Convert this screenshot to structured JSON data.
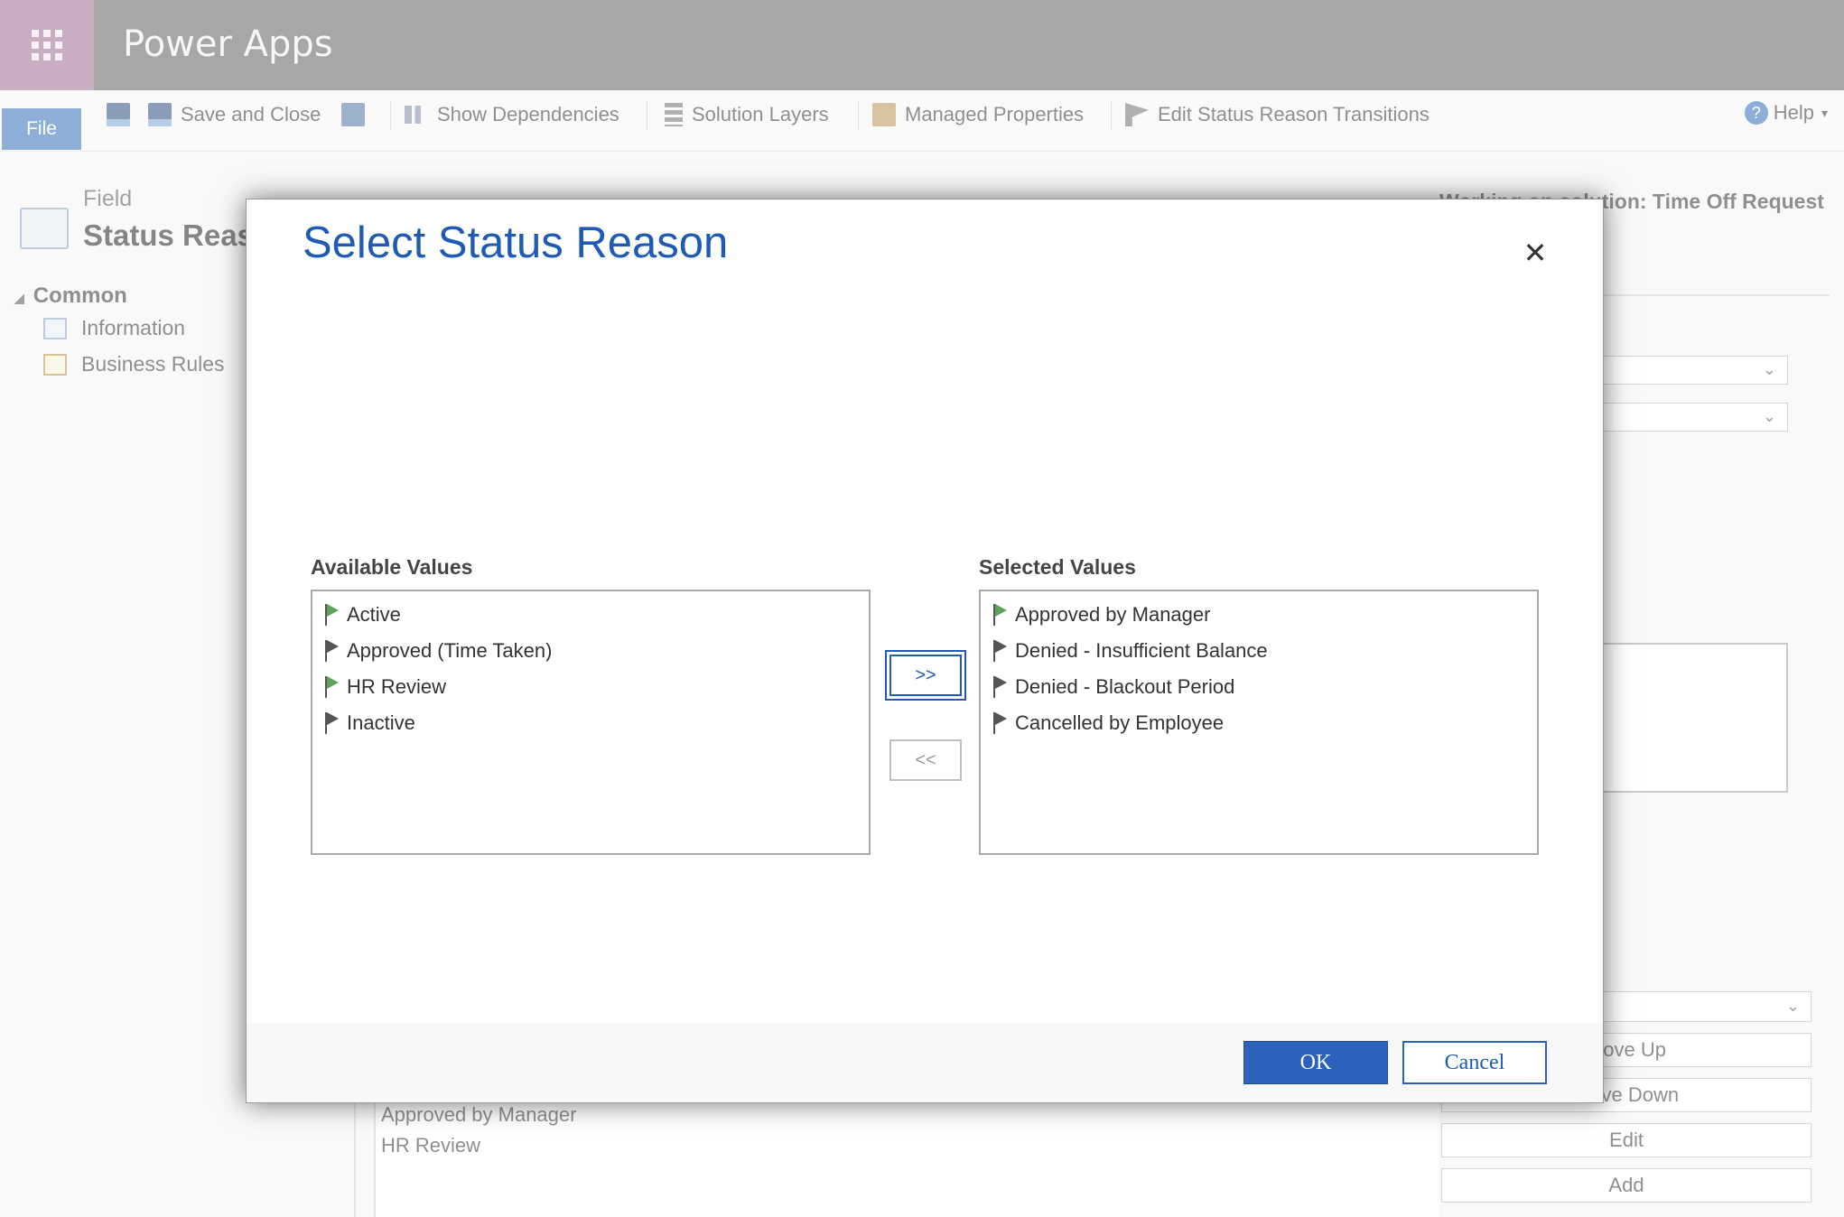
{
  "app": {
    "title": "Power Apps"
  },
  "ribbon": {
    "file_label": "File",
    "save_close_label": "Save and Close",
    "show_dependencies_label": "Show Dependencies",
    "solution_layers_label": "Solution Layers",
    "managed_properties_label": "Managed Properties",
    "edit_transitions_label": "Edit Status Reason Transitions",
    "help_label": "Help"
  },
  "field_header": {
    "kicker": "Field",
    "title": "Status Reason"
  },
  "nav": {
    "section": "Common",
    "items": [
      {
        "label": "Information"
      },
      {
        "label": "Business Rules"
      }
    ]
  },
  "background": {
    "working_on": "Working on solution: Time Off Request",
    "list_items": [
      "Approved by Manager",
      "HR Review"
    ],
    "buttons": [
      "Move Up",
      "Move Down",
      "Edit",
      "Add"
    ]
  },
  "dialog": {
    "title": "Select Status Reason",
    "available_label": "Available Values",
    "selected_label": "Selected Values",
    "available_values": [
      {
        "label": "Active",
        "flag": "green"
      },
      {
        "label": "Approved (Time Taken)",
        "flag": "gray"
      },
      {
        "label": "HR Review",
        "flag": "green"
      },
      {
        "label": "Inactive",
        "flag": "gray"
      }
    ],
    "selected_values": [
      {
        "label": "Approved by Manager",
        "flag": "green"
      },
      {
        "label": "Denied - Insufficient Balance",
        "flag": "gray"
      },
      {
        "label": "Denied - Blackout Period",
        "flag": "gray"
      },
      {
        "label": "Cancelled by Employee",
        "flag": "gray"
      }
    ],
    "add_label": ">>",
    "remove_label": "<<",
    "ok_label": "OK",
    "cancel_label": "Cancel",
    "close_glyph": "✕"
  },
  "colors": {
    "accent": "#1f5bb5",
    "topbar": "#5f5f5f",
    "waffle": "#9b6a93",
    "flag_green": "#5fa35a",
    "flag_gray": "#555555"
  }
}
